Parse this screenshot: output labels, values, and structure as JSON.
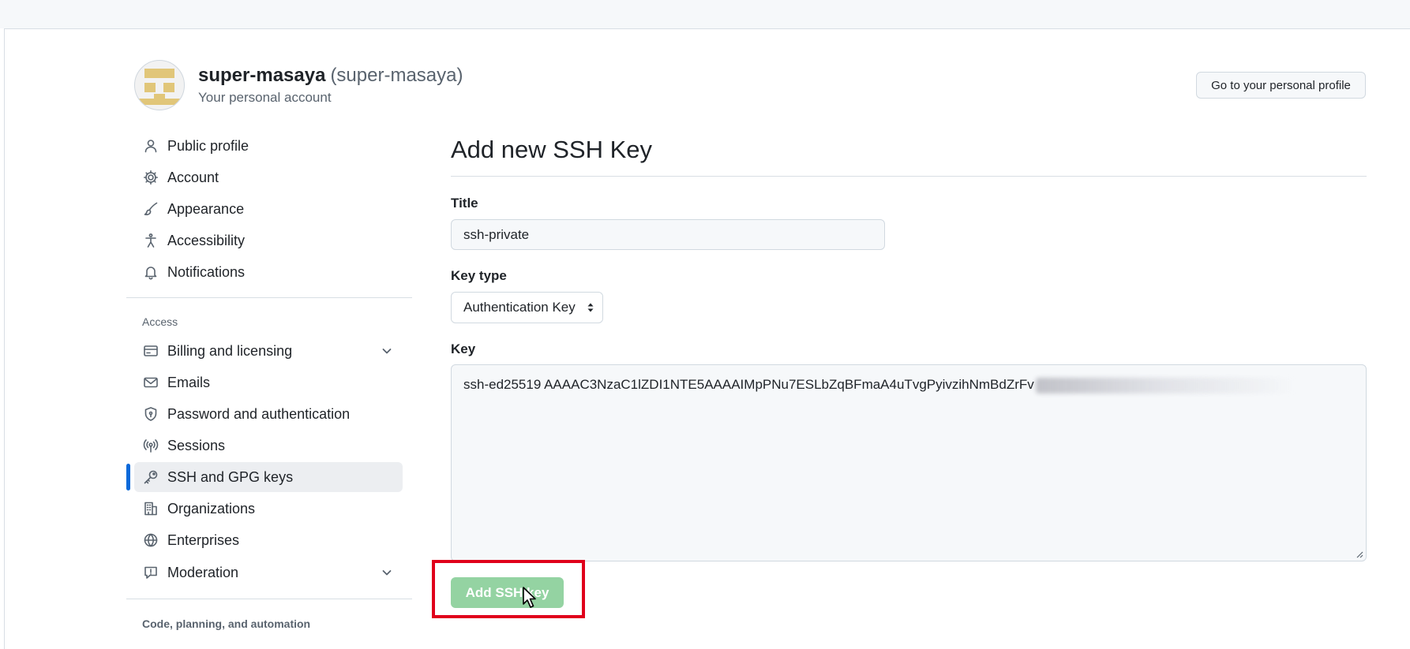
{
  "account": {
    "name": "super-masaya",
    "handle": "(super-masaya)",
    "subtitle": "Your personal account",
    "profile_button": "Go to your personal profile"
  },
  "sidebar": {
    "items_top": [
      {
        "label": "Public profile",
        "icon": "person-icon"
      },
      {
        "label": "Account",
        "icon": "gear-icon"
      },
      {
        "label": "Appearance",
        "icon": "paintbrush-icon"
      },
      {
        "label": "Accessibility",
        "icon": "accessibility-icon"
      },
      {
        "label": "Notifications",
        "icon": "bell-icon"
      }
    ],
    "access_label": "Access",
    "items_access": [
      {
        "label": "Billing and licensing",
        "icon": "credit-card-icon",
        "expandable": true
      },
      {
        "label": "Emails",
        "icon": "mail-icon"
      },
      {
        "label": "Password and authentication",
        "icon": "shield-lock-icon"
      },
      {
        "label": "Sessions",
        "icon": "broadcast-icon"
      },
      {
        "label": "SSH and GPG keys",
        "icon": "key-icon",
        "active": true
      },
      {
        "label": "Organizations",
        "icon": "organization-icon"
      },
      {
        "label": "Enterprises",
        "icon": "globe-icon"
      },
      {
        "label": "Moderation",
        "icon": "report-icon",
        "expandable": true
      }
    ],
    "code_label": "Code, planning, and automation"
  },
  "form": {
    "heading": "Add new SSH Key",
    "title_label": "Title",
    "title_value": "ssh-private",
    "key_type_label": "Key type",
    "key_type_value": "Authentication Key",
    "key_label": "Key",
    "key_value": "ssh-ed25519 AAAAC3NzaC1lZDI1NTE5AAAAIMpPNu7ESLbZqBFmaA4uTvgPyivzihNmBdZrFv",
    "submit_label": "Add SSH key"
  },
  "colors": {
    "accent": "#0969da",
    "submit_disabled": "#94d3a2",
    "highlight": "#e0001b"
  }
}
